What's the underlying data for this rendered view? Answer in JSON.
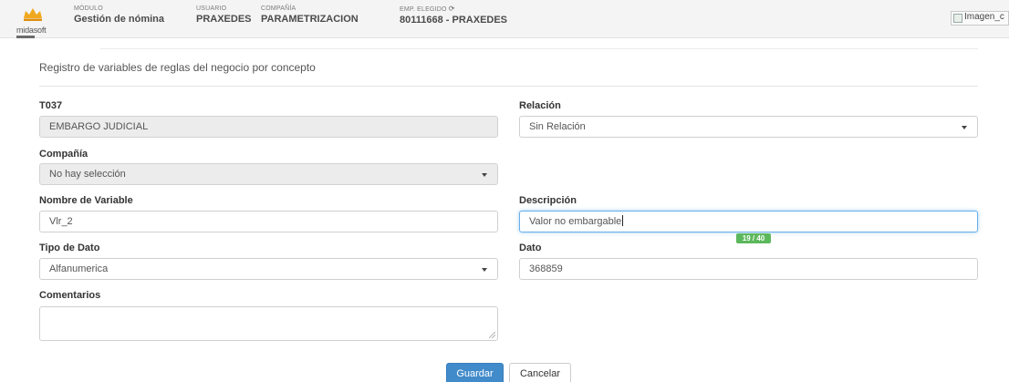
{
  "header": {
    "logo_text": "midasoft",
    "modulo": {
      "label": "MÓDULO",
      "value": "Gestión de nómina"
    },
    "usuario": {
      "label": "USUARIO",
      "value": "PRAXEDES"
    },
    "compania": {
      "label": "COMPAÑÍA",
      "value": "PARAMETRIZACION"
    },
    "empleado": {
      "label": "EMP. ELEGIDO",
      "value": "80111668 - PRAXEDES"
    },
    "broken_image_alt": "Imagen_c"
  },
  "form": {
    "title": "Registro de variables de reglas del negocio por concepto",
    "concept": {
      "label": "T037",
      "value": "EMBARGO JUDICIAL"
    },
    "relacion": {
      "label": "Relación",
      "value": "Sin Relación"
    },
    "compania": {
      "label": "Compañía",
      "value": "No hay selección"
    },
    "nombre_variable": {
      "label": "Nombre de Variable",
      "value": "Vlr_2"
    },
    "descripcion": {
      "label": "Descripción",
      "value": "Valor no embargable",
      "counter": "19 / 40"
    },
    "tipo_dato": {
      "label": "Tipo de Dato",
      "value": "Alfanumerica"
    },
    "dato": {
      "label": "Dato",
      "value": "368859"
    },
    "comentarios": {
      "label": "Comentarios",
      "value": ""
    }
  },
  "actions": {
    "save_label": "Guardar",
    "cancel_label": "Cancelar"
  },
  "colors": {
    "primary": "#428bca",
    "counter_badge": "#5cb85c",
    "focus": "#66afe9",
    "logo_crown": "#f0a81e"
  },
  "icons": [
    "crown-logo-icon",
    "refresh-icon",
    "broken-image-icon",
    "chevron-down-icon",
    "resize-grip-icon"
  ]
}
